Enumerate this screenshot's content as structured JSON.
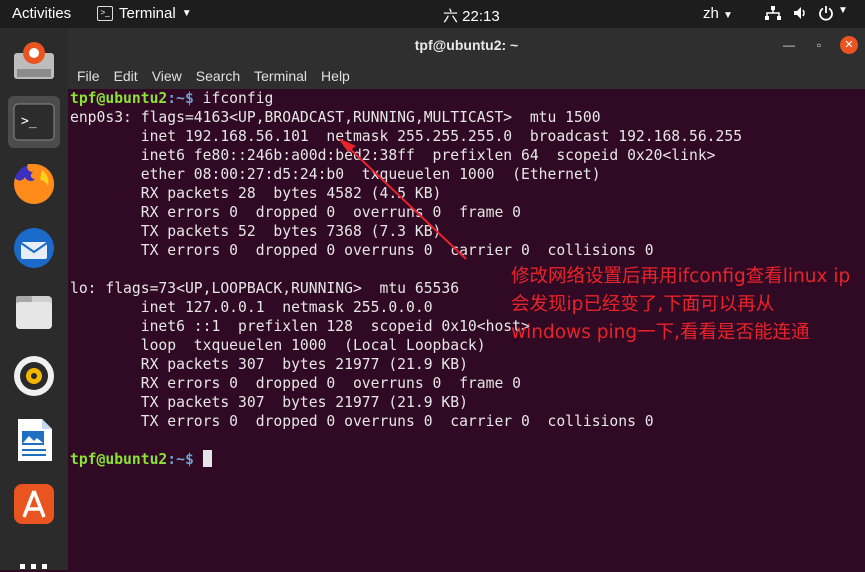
{
  "topbar": {
    "activities": "Activities",
    "app_menu": "Terminal",
    "clock": "六 22:13",
    "lang": "zh"
  },
  "window": {
    "title": "tpf@ubuntu2: ~",
    "menu": [
      "File",
      "Edit",
      "View",
      "Search",
      "Terminal",
      "Help"
    ]
  },
  "terminal": {
    "prompt_user": "tpf@ubuntu2",
    "prompt_path": ":~$",
    "command": " ifconfig",
    "lines": [
      "enp0s3: flags=4163<UP,BROADCAST,RUNNING,MULTICAST>  mtu 1500",
      "        inet 192.168.56.101  netmask 255.255.255.0  broadcast 192.168.56.255",
      "        inet6 fe80::246b:a00d:bed2:38ff  prefixlen 64  scopeid 0x20<link>",
      "        ether 08:00:27:d5:24:b0  txqueuelen 1000  (Ethernet)",
      "        RX packets 28  bytes 4582 (4.5 KB)",
      "        RX errors 0  dropped 0  overruns 0  frame 0",
      "        TX packets 52  bytes 7368 (7.3 KB)",
      "        TX errors 0  dropped 0 overruns 0  carrier 0  collisions 0",
      "",
      "lo: flags=73<UP,LOOPBACK,RUNNING>  mtu 65536",
      "        inet 127.0.0.1  netmask 255.0.0.0",
      "        inet6 ::1  prefixlen 128  scopeid 0x10<host>",
      "        loop  txqueuelen 1000  (Local Loopback)",
      "        RX packets 307  bytes 21977 (21.9 KB)",
      "        RX errors 0  dropped 0  overruns 0  frame 0",
      "        TX packets 307  bytes 21977 (21.9 KB)",
      "        TX errors 0  dropped 0 overruns 0  carrier 0  collisions 0",
      ""
    ]
  },
  "annotation": {
    "text": "修改网络设置后再用ifconfig查看linux ip会发现ip已经变了,下面可以再从windows ping一下,看看是否能连通",
    "color": "#e8232a"
  },
  "dock": {
    "icons": [
      "software-updater-icon",
      "terminal-icon",
      "firefox-icon",
      "thunderbird-icon",
      "files-icon",
      "rhythmbox-icon",
      "libreoffice-writer-icon",
      "ubuntu-software-icon",
      "show-apps-icon"
    ]
  }
}
